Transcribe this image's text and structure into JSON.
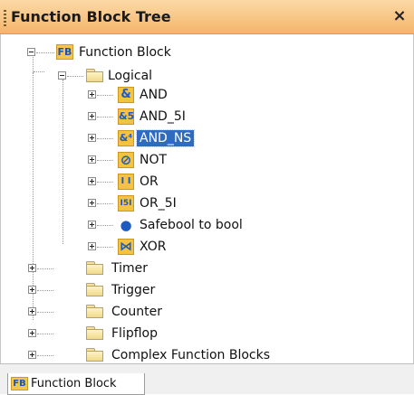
{
  "panel": {
    "title": "Function Block Tree",
    "close_symbol": "×"
  },
  "tree": {
    "root": {
      "icon_text": "FB",
      "label": "Function Block"
    },
    "logical": {
      "label": "Logical",
      "items": [
        {
          "label": "AND",
          "icon": "and-gate-icon",
          "glyph": "&"
        },
        {
          "label": "AND_5I",
          "icon": "and-5-input-icon",
          "glyph": "&5"
        },
        {
          "label": "AND_NS",
          "icon": "and-ns-icon",
          "glyph": "&⁴",
          "selected": true
        },
        {
          "label": "NOT",
          "icon": "not-gate-icon",
          "glyph": "⊘"
        },
        {
          "label": "OR",
          "icon": "or-gate-icon",
          "glyph": "I I"
        },
        {
          "label": "OR_5I",
          "icon": "or-5-input-icon",
          "glyph": "I5I"
        },
        {
          "label": "Safebool to bool",
          "icon": "safebool-icon",
          "glyph": "●"
        },
        {
          "label": "XOR",
          "icon": "xor-gate-icon",
          "glyph": "⋈"
        }
      ]
    },
    "folders": [
      {
        "label": "Timer"
      },
      {
        "label": "Trigger"
      },
      {
        "label": "Counter"
      },
      {
        "label": "Flipflop"
      },
      {
        "label": "Complex Function Blocks"
      }
    ]
  },
  "bottom_tab": {
    "icon_text": "FB",
    "label": "Function Block"
  },
  "colors": {
    "title_bar": "#f4b56a",
    "selection": "#2f6cc0",
    "icon_fill": "#f5c342"
  }
}
